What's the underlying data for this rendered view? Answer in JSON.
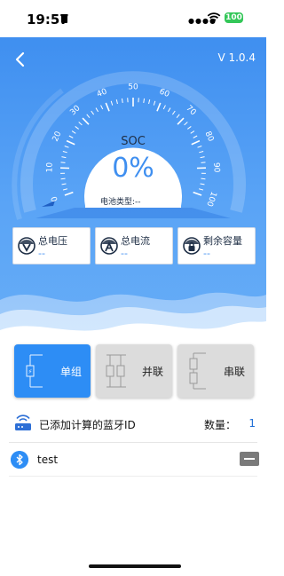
{
  "status": {
    "time": "19:57",
    "battery": "100"
  },
  "header": {
    "version": "V 1.0.4"
  },
  "gauge": {
    "title": "SOC",
    "value": "0%",
    "battery_type_label": "电池类型:--",
    "ticks": [
      "0",
      "10",
      "20",
      "30",
      "40",
      "50",
      "60",
      "70",
      "80",
      "90",
      "100"
    ]
  },
  "metrics": [
    {
      "label": "总电压",
      "value": "--",
      "icon": "voltage-icon"
    },
    {
      "label": "总电流",
      "value": "--",
      "icon": "ampere-icon"
    },
    {
      "label": "剩余容量",
      "value": "--",
      "icon": "capacity-lock-icon"
    }
  ],
  "modes": [
    {
      "label": "单组",
      "active": true
    },
    {
      "label": "并联",
      "active": false
    },
    {
      "label": "串联",
      "active": false
    }
  ],
  "bluetooth": {
    "title": "已添加计算的蓝牙ID",
    "count_label": "数量：",
    "count": "1",
    "devices": [
      {
        "name": "test"
      }
    ]
  },
  "colors": {
    "primary": "#3f8ff0",
    "active_mode": "#2d8df5",
    "inactive_mode": "#dcdcdc"
  }
}
